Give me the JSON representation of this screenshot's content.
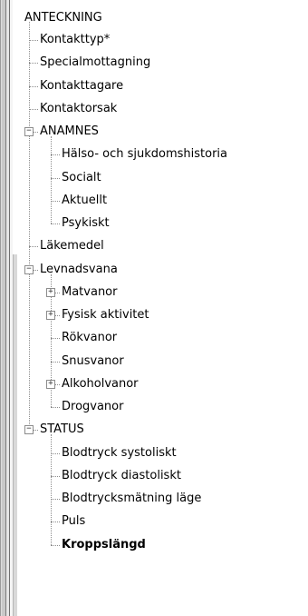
{
  "tree": {
    "root": "ANTECKNING",
    "items": [
      {
        "label": "Kontakttyp*",
        "level": 1
      },
      {
        "label": "Specialmottagning",
        "level": 1
      },
      {
        "label": "Kontakttagare",
        "level": 1
      },
      {
        "label": "Kontaktorsak",
        "level": 1
      },
      {
        "label": "ANAMNES",
        "level": 1,
        "expander": "−"
      },
      {
        "label": "Hälso- och sjukdomshistoria",
        "level": 2
      },
      {
        "label": "Socialt",
        "level": 2
      },
      {
        "label": "Aktuellt",
        "level": 2
      },
      {
        "label": "Psykiskt",
        "level": 2
      },
      {
        "label": "Läkemedel",
        "level": 1
      },
      {
        "label": "Levnadsvana",
        "level": 1,
        "expander": "−"
      },
      {
        "label": "Matvanor",
        "level": 2,
        "expander": "+"
      },
      {
        "label": "Fysisk aktivitet",
        "level": 2,
        "expander": "+"
      },
      {
        "label": "Rökvanor",
        "level": 2
      },
      {
        "label": "Snusvanor",
        "level": 2
      },
      {
        "label": "Alkoholvanor",
        "level": 2,
        "expander": "+"
      },
      {
        "label": "Drogvanor",
        "level": 2
      },
      {
        "label": "STATUS",
        "level": 1,
        "expander": "−"
      },
      {
        "label": "Blodtryck systoliskt",
        "level": 2
      },
      {
        "label": "Blodtryck diastoliskt",
        "level": 2
      },
      {
        "label": "Blodtrycksmätning läge",
        "level": 2
      },
      {
        "label": "Puls",
        "level": 2
      },
      {
        "label": "Kroppslängd",
        "level": 2,
        "selected": true
      }
    ]
  }
}
